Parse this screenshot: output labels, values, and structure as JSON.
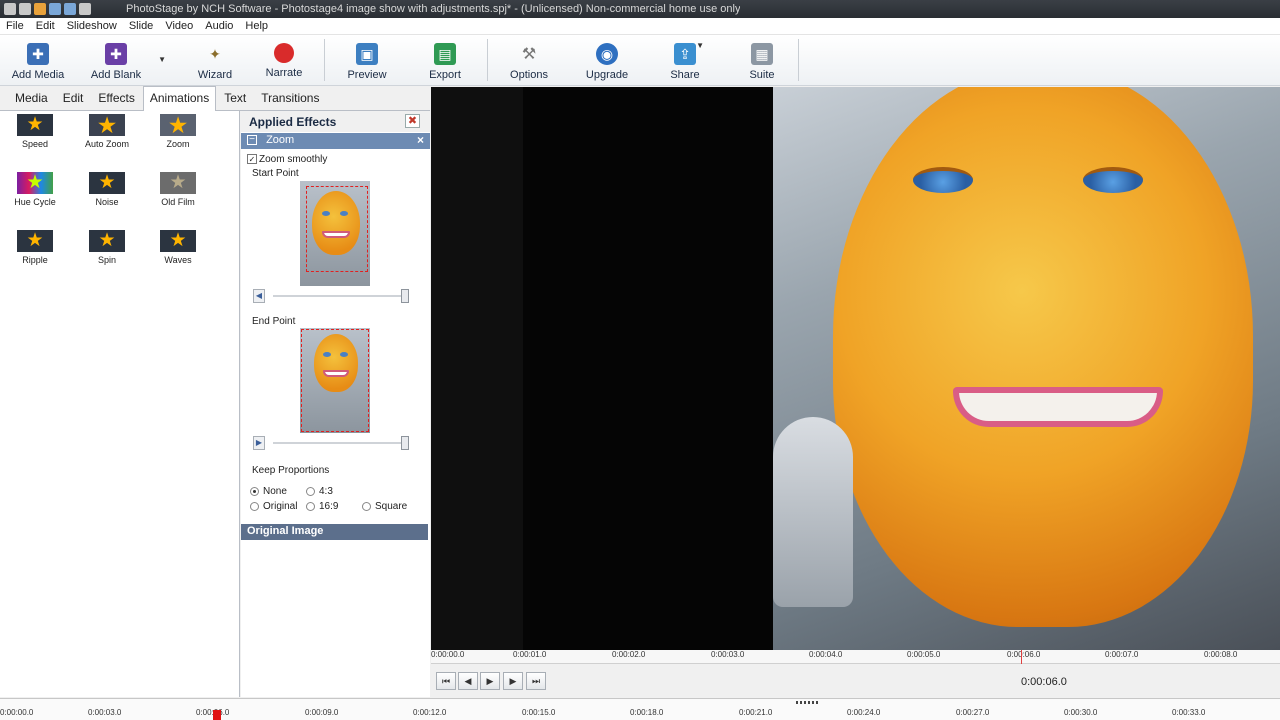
{
  "window": {
    "title": "PhotoStage by NCH Software - Photostage4 image show with adjustments.spj* - (Unlicensed) Non-commercial home use only"
  },
  "menu": [
    "File",
    "Edit",
    "Slideshow",
    "Slide",
    "Video",
    "Audio",
    "Help"
  ],
  "toolbar": {
    "add_media": "Add Media",
    "add_blank": "Add Blank",
    "wizard": "Wizard",
    "narrate": "Narrate",
    "preview": "Preview",
    "export": "Export",
    "options": "Options",
    "upgrade": "Upgrade",
    "share": "Share",
    "suite": "Suite"
  },
  "tabs": {
    "media": "Media",
    "edit": "Edit",
    "effects": "Effects",
    "animations": "Animations",
    "text": "Text",
    "transitions": "Transitions",
    "active": "Animations"
  },
  "animations": {
    "speed": "Speed",
    "auto_zoom": "Auto Zoom",
    "zoom": "Zoom",
    "hue_cycle": "Hue Cycle",
    "noise": "Noise",
    "old_film": "Old Film",
    "ripple": "Ripple",
    "spin": "Spin",
    "waves": "Waves"
  },
  "applied_effects": {
    "title": "Applied Effects",
    "zoom_header": "Zoom",
    "zoom_smoothly": "Zoom smoothly",
    "zoom_smoothly_checked": true,
    "start_point": "Start Point",
    "end_point": "End Point",
    "keep_proportions": "Keep Proportions",
    "proportion_options": {
      "none": "None",
      "ratio_4_3": "4:3",
      "original": "Original",
      "ratio_16_9": "16:9",
      "square": "Square"
    },
    "selected_proportion": "None",
    "original_image": "Original Image"
  },
  "preview_ruler": [
    "0:00:00.0",
    "0:00:01.0",
    "0:00:02.0",
    "0:00:03.0",
    "0:00:04.0",
    "0:00:05.0",
    "0:00:06.0",
    "0:00:07.0",
    "0:00:08.0"
  ],
  "transport": {
    "current_time": "0:00:06.0"
  },
  "timeline_ruler": [
    "0:00:00.0",
    "0:00:03.0",
    "0:00:06.0",
    "0:00:09.0",
    "0:00:12.0",
    "0:00:15.0",
    "0:00:18.0",
    "0:00:21.0",
    "0:00:24.0",
    "0:00:27.0",
    "0:00:30.0",
    "0:00:33.0"
  ],
  "colors": {
    "panel_header": "#6d8bb3",
    "original_header": "#5c6f8c",
    "playhead": "#e01010",
    "star": "#ffb400"
  }
}
